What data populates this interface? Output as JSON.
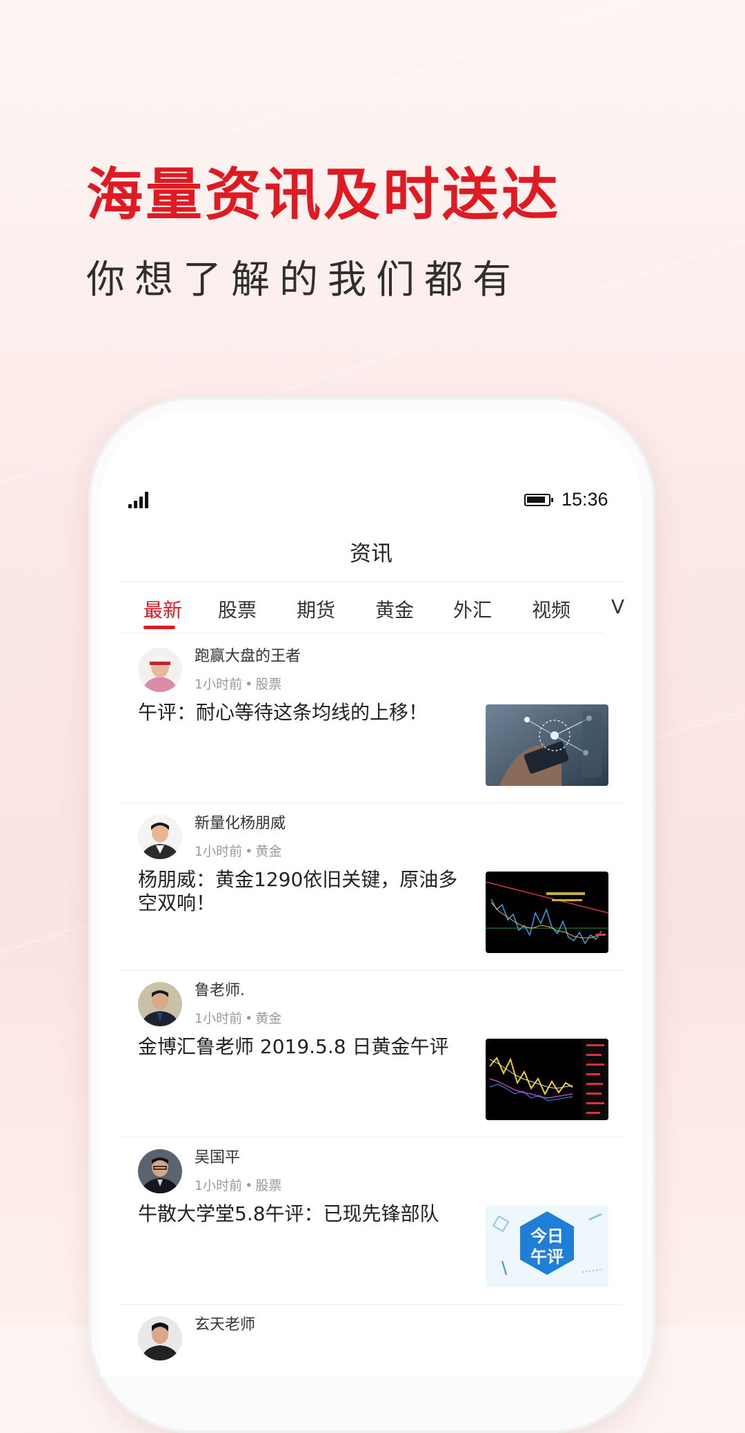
{
  "promo": {
    "title": "海量资讯及时送达",
    "subtitle": "你想了解的我们都有"
  },
  "status_bar": {
    "time": "15:36"
  },
  "nav": {
    "title": "资讯"
  },
  "tabs": [
    {
      "label": "最新",
      "active": true
    },
    {
      "label": "股票",
      "active": false
    },
    {
      "label": "期货",
      "active": false
    },
    {
      "label": "黄金",
      "active": false
    },
    {
      "label": "外汇",
      "active": false
    },
    {
      "label": "视频",
      "active": false
    },
    {
      "label": "V",
      "active": false
    }
  ],
  "feed": [
    {
      "author": "跑赢大盘的王者",
      "time": "1小时前",
      "category": "股票",
      "headline": "午评：耐心等待这条均线的上移！",
      "thumbnail": "smartphone-network-image"
    },
    {
      "author": "新量化杨朋威",
      "time": "1小时前",
      "category": "黄金",
      "headline": "杨朋威：黄金1290依旧关键，原油多空双响！",
      "thumbnail": "gold-candlestick-chart-image"
    },
    {
      "author": "鲁老师.",
      "time": "1小时前",
      "category": "黄金",
      "headline": "金博汇鲁老师 2019.5.8 日黄金午评",
      "thumbnail": "gold-kline-chart-image"
    },
    {
      "author": "吴国平",
      "time": "1小时前",
      "category": "股票",
      "headline": "牛散大学堂5.8午评：已现先锋部队",
      "thumbnail": "midday-review-badge-image",
      "thumbnail_text_line1": "今日",
      "thumbnail_text_line2": "午评"
    },
    {
      "author": "玄天老师"
    }
  ],
  "colors": {
    "accent": "#e01a22",
    "text_primary": "#222222",
    "text_secondary": "#999999"
  }
}
